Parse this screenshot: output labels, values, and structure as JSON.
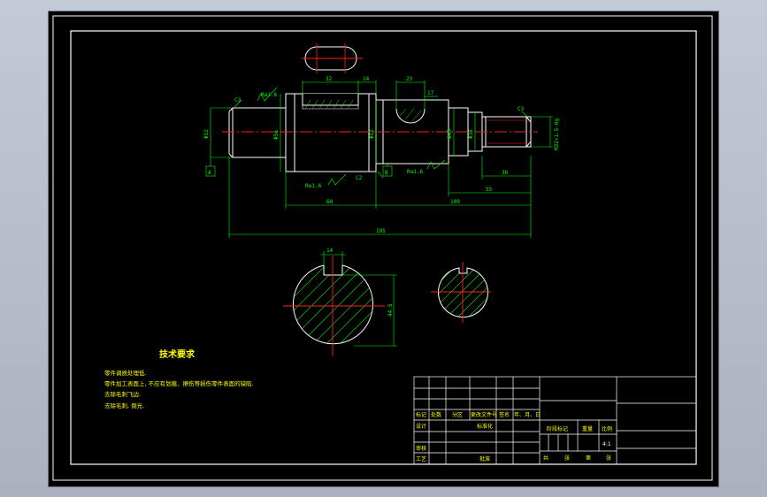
{
  "drawing": {
    "dimensions": {
      "d32": "32",
      "d14": "14",
      "d23": "23",
      "d17": "17",
      "c3_left": "C3",
      "c3_right": "C3",
      "c2": "C2",
      "phi_left": "Φ52",
      "phi_mid": "Φ56",
      "phi_b": "Φ52",
      "phi_r1": "Φ45",
      "phi_r2": "Φ35",
      "thread": "M32×1.5-6g",
      "d36": "36",
      "d55": "55",
      "d60": "60",
      "d109": "109",
      "d195": "195",
      "ra_top": "Ra1.6",
      "ra_bottom": "Ra1.6",
      "ra_right": "Ra1.6",
      "datum_a": "A",
      "datum_b": "B",
      "sec_key": "14",
      "sec_depth": "44.5"
    },
    "notes": {
      "title": "技术要求",
      "items": [
        "零件调质处理低. ",
        "零件加工表面上, 不应有划痕、擦伤等损伤零件表面的缺陷.",
        "去除毛刺飞边.",
        "去除毛刺, 倒光."
      ]
    },
    "title_block": {
      "c1": "标记",
      "c2": "处数",
      "c3": "分区",
      "c4": "更改文件号",
      "c5": "签名",
      "c6": "年、月、日",
      "design": "设计",
      "standard": "标准化",
      "review": "审核",
      "process": "工艺",
      "approve": "批准",
      "stage": "阶段标记",
      "weight": "重量",
      "ratio": "比例",
      "scale": "4:1",
      "total": "共",
      "sheets": "张",
      "page": "第",
      "sheet2": "张"
    }
  }
}
